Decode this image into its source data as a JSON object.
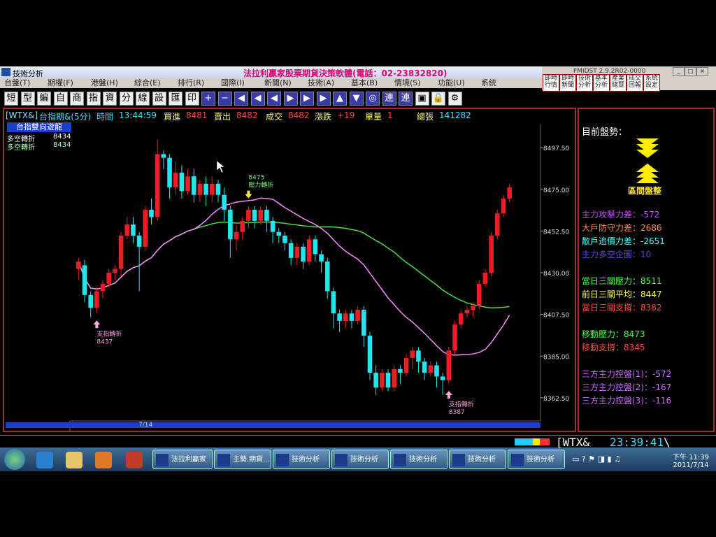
{
  "window": {
    "title": "技術分析",
    "banner": "法拉利贏家股票期貨決策軟體(電話：02-23832820)",
    "fmidst_title": "FMIDST 2.9.2R02-0000"
  },
  "menu": [
    "台盤(T)",
    "期權(F)",
    "港盤(H)",
    "綜合(E)",
    "排行(R)",
    "國際(I)",
    "新聞(N)",
    "技術(A)",
    "基本(B)",
    "情境(S)",
    "功能(U)",
    "系統"
  ],
  "top_buttons": [
    "即時行情",
    "即時新聞",
    "技術分析",
    "基本分析",
    "產業總覽",
    "成交回報",
    "系統設定"
  ],
  "toolbar_buttons": [
    "短",
    "型",
    "編",
    "自",
    "商",
    "指",
    "資",
    "分",
    "線",
    "設",
    "匯",
    "印",
    "+",
    "−",
    "◀",
    "◀",
    "◀",
    "▶",
    "▶",
    "▶",
    "▲",
    "▼",
    "◎",
    "連",
    "連",
    "▣",
    "🔒",
    "⚙"
  ],
  "info_bar": {
    "symbol": "[WTX&]",
    "name": "台指期&(5分)",
    "time_label": "時間",
    "time": "13:44:59",
    "bid_label": "買進",
    "bid": "8481",
    "ask_label": "賣出",
    "ask": "8482",
    "deal_label": "成交",
    "deal": "8482",
    "change_label": "漲跌",
    "change": "+19",
    "vol_label": "單量",
    "vol": "1",
    "total_label": "總張",
    "total": "141282"
  },
  "legend": {
    "title": "台指雙向遊龍",
    "items": [
      {
        "label": "多空轉折",
        "value": "8434",
        "color": "#ffffff"
      },
      {
        "label": "多空轉折",
        "value": "8434",
        "color": "#b0ffb0"
      }
    ]
  },
  "chart_data": {
    "type": "candlestick",
    "y_ticks": [
      "8497.50",
      "8475.00",
      "8452.50",
      "8430.00",
      "8407.50",
      "8385.00",
      "8362.50"
    ],
    "ylim": [
      8350,
      8510
    ],
    "x_label": "7/14",
    "candles": [
      [
        8432,
        8436,
        8426,
        8438
      ],
      [
        8434,
        8418,
        8414,
        8437
      ],
      [
        8418,
        8411,
        8406,
        8420
      ],
      [
        8411,
        8420,
        8408,
        8422
      ],
      [
        8420,
        8424,
        8416,
        8426
      ],
      [
        8424,
        8430,
        8422,
        8432
      ],
      [
        8430,
        8432,
        8426,
        8434
      ],
      [
        8432,
        8450,
        8428,
        8452
      ],
      [
        8450,
        8456,
        8448,
        8460
      ],
      [
        8456,
        8450,
        8446,
        8460
      ],
      [
        8450,
        8444,
        8420,
        8452
      ],
      [
        8444,
        8464,
        8442,
        8466
      ],
      [
        8464,
        8460,
        8456,
        8470
      ],
      [
        8460,
        8494,
        8458,
        8502
      ],
      [
        8494,
        8492,
        8486,
        8496
      ],
      [
        8492,
        8476,
        8470,
        8494
      ],
      [
        8476,
        8484,
        8472,
        8490
      ],
      [
        8484,
        8474,
        8470,
        8488
      ],
      [
        8474,
        8482,
        8472,
        8486
      ],
      [
        8482,
        8472,
        8468,
        8486
      ],
      [
        8472,
        8478,
        8468,
        8480
      ],
      [
        8478,
        8472,
        8466,
        8482
      ],
      [
        8472,
        8478,
        8468,
        8482
      ],
      [
        8478,
        8472,
        8468,
        8480
      ],
      [
        8472,
        8464,
        8458,
        8476
      ],
      [
        8464,
        8448,
        8438,
        8466
      ],
      [
        8448,
        8452,
        8442,
        8456
      ],
      [
        8452,
        8458,
        8448,
        8460
      ],
      [
        8458,
        8464,
        8454,
        8466
      ],
      [
        8464,
        8458,
        8454,
        8466
      ],
      [
        8458,
        8464,
        8456,
        8466
      ],
      [
        8464,
        8458,
        8452,
        8466
      ],
      [
        8458,
        8452,
        8446,
        8460
      ],
      [
        8452,
        8450,
        8446,
        8454
      ],
      [
        8450,
        8446,
        8442,
        8452
      ],
      [
        8446,
        8438,
        8434,
        8448
      ],
      [
        8438,
        8444,
        8434,
        8446
      ],
      [
        8444,
        8436,
        8432,
        8446
      ],
      [
        8436,
        8448,
        8434,
        8450
      ],
      [
        8448,
        8440,
        8436,
        8450
      ],
      [
        8440,
        8436,
        8430,
        8442
      ],
      [
        8436,
        8420,
        8416,
        8438
      ],
      [
        8420,
        8408,
        8400,
        8422
      ],
      [
        8408,
        8404,
        8398,
        8410
      ],
      [
        8404,
        8408,
        8400,
        8410
      ],
      [
        8408,
        8404,
        8400,
        8410
      ],
      [
        8404,
        8410,
        8402,
        8412
      ],
      [
        8410,
        8396,
        8390,
        8412
      ],
      [
        8396,
        8376,
        8372,
        8398
      ],
      [
        8376,
        8368,
        8364,
        8380
      ],
      [
        8368,
        8376,
        8366,
        8378
      ],
      [
        8376,
        8368,
        8366,
        8378
      ],
      [
        8368,
        8378,
        8366,
        8380
      ],
      [
        8378,
        8376,
        8370,
        8380
      ],
      [
        8376,
        8384,
        8374,
        8386
      ],
      [
        8384,
        8388,
        8378,
        8390
      ],
      [
        8388,
        8382,
        8376,
        8390
      ],
      [
        8382,
        8376,
        8372,
        8384
      ],
      [
        8376,
        8380,
        8374,
        8382
      ],
      [
        8380,
        8374,
        8368,
        8382
      ],
      [
        8374,
        8372,
        8364,
        8376
      ],
      [
        8372,
        8388,
        8370,
        8390
      ],
      [
        8388,
        8402,
        8386,
        8404
      ],
      [
        8402,
        8408,
        8400,
        8410
      ],
      [
        8408,
        8410,
        8406,
        8412
      ],
      [
        8410,
        8412,
        8406,
        8414
      ],
      [
        8412,
        8424,
        8410,
        8426
      ],
      [
        8424,
        8430,
        8422,
        8432
      ],
      [
        8430,
        8450,
        8428,
        8452
      ],
      [
        8450,
        8462,
        8448,
        8464
      ],
      [
        8462,
        8470,
        8460,
        8472
      ],
      [
        8470,
        8476,
        8468,
        8478
      ]
    ],
    "series": [
      {
        "name": "",
        "color": "#44dd44"
      },
      {
        "name": "",
        "color": "#ff88ff"
      }
    ],
    "annotations": [
      {
        "text1": "支指轉折",
        "text2": "8437",
        "index": 3,
        "dir": "up"
      },
      {
        "text1": "8475",
        "text2": "壓力轉折",
        "index": 28,
        "dir": "down"
      },
      {
        "text1": "支指轉折",
        "text2": "8387",
        "index": 61,
        "dir": "up"
      }
    ]
  },
  "side_panel": {
    "title": "目前盤勢：",
    "trend_label": "區間盤整",
    "rows": [
      {
        "text": "主力攻擊力差：-572",
        "color": "#cc44ff"
      },
      {
        "text": "大戶防守力差：2686",
        "color": "#ff8844"
      },
      {
        "text": "散戶追價力差：-2651",
        "color": "#44ffff"
      },
      {
        "text": "主力多空企圖：10",
        "color": "#6644cc"
      },
      {
        "text": "",
        "color": "#000"
      },
      {
        "text": "當日三關壓力：8511",
        "color": "#44ff44"
      },
      {
        "text": "前日三關平均：8447",
        "color": "#ffff44"
      },
      {
        "text": "當日三關支撐：8382",
        "color": "#ff4444"
      },
      {
        "text": "",
        "color": "#000"
      },
      {
        "text": "移動壓力：8473",
        "color": "#44ff44"
      },
      {
        "text": "移動支撐：8345",
        "color": "#ff4444"
      },
      {
        "text": "",
        "color": "#000"
      },
      {
        "text": "三方主力控盤(1)：-572",
        "color": "#cc66ff"
      },
      {
        "text": "三方主力控盤(2)：-167",
        "color": "#cc66ff"
      },
      {
        "text": "三方主力控盤(3)：-116",
        "color": "#cc66ff"
      }
    ]
  },
  "ticker": {
    "symbol": "WTX&",
    "time": "23:39:41"
  },
  "taskbar": {
    "items": [
      "法拉利贏家",
      "主勢.期貨...",
      "技術分析",
      "技術分析",
      "技術分析",
      "技術分析",
      "技術分析"
    ],
    "clock_period": "下午 11:39",
    "date": "2011/7/14"
  }
}
